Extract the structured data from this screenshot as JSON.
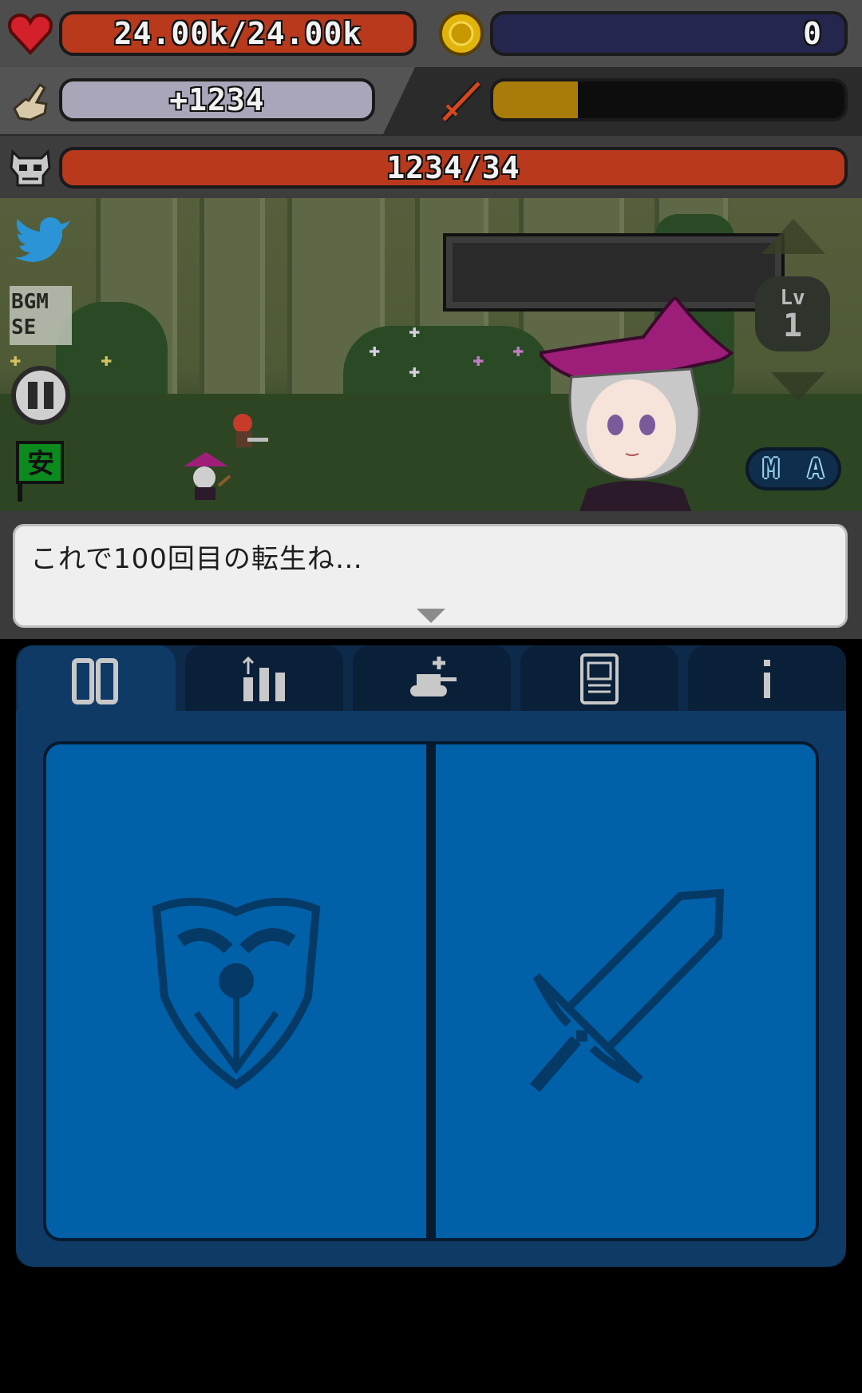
{
  "status": {
    "hp_text": "24.00k/24.00k",
    "gold_text": "0",
    "tap_text": "+1234",
    "special_gauge_fraction": 0.24,
    "kill_text": "1234/34"
  },
  "icons": {
    "hp": "heart-icon",
    "gold": "coin-icon",
    "tap": "pointing-hand-icon",
    "gauge": "sword-slash-icon",
    "kill": "skull-icon"
  },
  "scene": {
    "bgm_label": "BGM",
    "se_label": "SE",
    "safe_label": "安",
    "level_label": "Lv",
    "level_value": "1",
    "toggle_m": "M",
    "toggle_a": "A"
  },
  "dialog": {
    "text": "これで100回目の転生ね…"
  },
  "menu": {
    "tabs": [
      "cards-icon",
      "stats-upgrade-icon",
      "tank-add-icon",
      "terminal-icon",
      "info-icon"
    ],
    "cards": [
      "shield-icon",
      "sword-icon"
    ]
  },
  "colors": {
    "hp_red": "#b8391c",
    "gold_navy": "#25264d",
    "gauge_amber": "#a97b0a",
    "panel_blue": "#0060a8",
    "dark_navy": "#0d2a4a"
  }
}
